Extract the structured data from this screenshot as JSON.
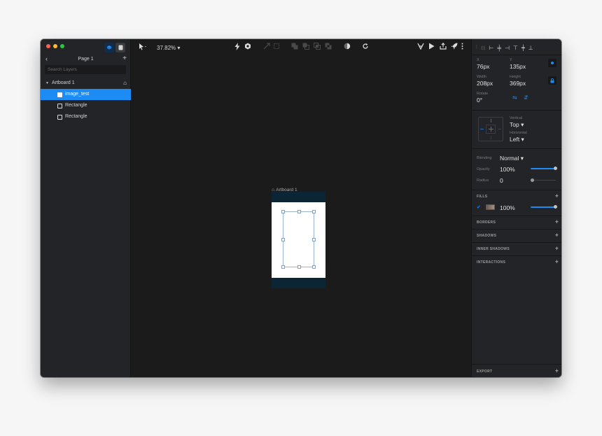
{
  "sidebar": {
    "page_title": "Page 1",
    "search_placeholder": "Search Layers",
    "layers": [
      {
        "label": "Artboard 1",
        "type": "artboard"
      },
      {
        "label": "image_test",
        "type": "image",
        "selected": true
      },
      {
        "label": "Rectangle",
        "type": "shape"
      },
      {
        "label": "Rectangle",
        "type": "shape"
      }
    ]
  },
  "toolbar": {
    "zoom": "37.82%",
    "icons": [
      "select-arrow-icon",
      "lightning-icon",
      "hexagon-icon",
      "resize-icon",
      "frame-icon",
      "union-icon",
      "subtract-icon",
      "intersect-icon",
      "difference-icon",
      "mask-icon",
      "refresh-icon",
      "flatten-icon",
      "play-icon",
      "share-icon",
      "rocket-icon",
      "more-icon"
    ]
  },
  "canvas": {
    "artboard_label": "Artboard 1"
  },
  "inspector": {
    "x_label": "X",
    "x_value": "76px",
    "y_label": "Y",
    "y_value": "135px",
    "width_label": "Width",
    "width_value": "208px",
    "height_label": "Height",
    "height_value": "369px",
    "rotate_label": "Rotate",
    "rotate_value": "0°",
    "vertical_label": "Vertical",
    "vertical_value": "Top",
    "horizontal_label": "Horizontal",
    "horizontal_value": "Left",
    "blending_label": "Blending",
    "blending_value": "Normal",
    "opacity_label": "Opacity",
    "opacity_value": "100%",
    "radius_label": "Radius",
    "radius_value": "0",
    "fills_title": "FILLS",
    "fill_opacity": "100%",
    "borders_title": "BORDERS",
    "shadows_title": "SHADOWS",
    "inner_shadows_title": "INNER SHADOWS",
    "interactions_title": "INTERACTIONS",
    "export_title": "EXPORT"
  },
  "colors": {
    "accent": "#1c8bf4",
    "window_bg": "#1b1b1b",
    "panel_bg": "#232427",
    "artboard_band": "#0c2535",
    "close": "#fe5f57",
    "minimize": "#febc2e",
    "zoom": "#28c840"
  }
}
